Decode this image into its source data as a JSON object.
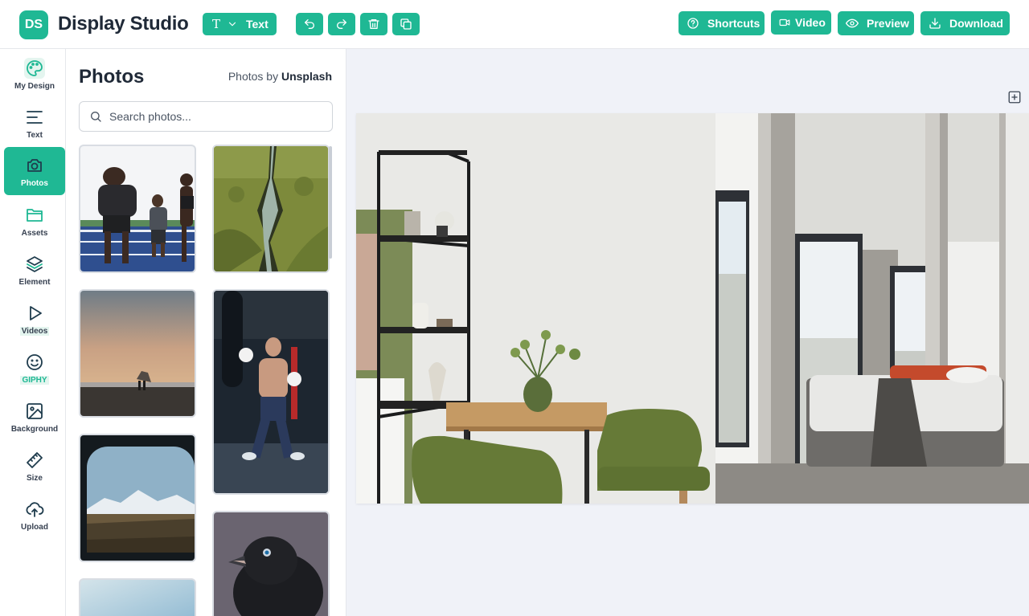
{
  "app": {
    "logo_initials": "DS",
    "title": "Display Studio",
    "accent": "#1fb894"
  },
  "toolbar": {
    "text_tool_glyph": "T",
    "text_tool_label": "Text",
    "undo_icon": "undo-icon",
    "redo_icon": "redo-icon",
    "delete_icon": "trash-icon",
    "duplicate_icon": "duplicate-icon"
  },
  "header_actions": {
    "shortcuts_label": "Shortcuts",
    "video_label": "Video",
    "preview_label": "Preview",
    "download_label": "Download"
  },
  "sidebar": {
    "items": [
      {
        "label": "My Design",
        "icon": "palette-icon"
      },
      {
        "label": "Text",
        "icon": "text-lines-icon"
      },
      {
        "label": "Photos",
        "icon": "camera-icon",
        "active": true
      },
      {
        "label": "Assets",
        "icon": "folder-icon"
      },
      {
        "label": "Element",
        "icon": "layers-icon"
      },
      {
        "label": "Videos",
        "icon": "play-icon"
      },
      {
        "label": "GIPHY",
        "icon": "smiley-icon"
      },
      {
        "label": "Background",
        "icon": "image-icon"
      },
      {
        "label": "Size",
        "icon": "ruler-icon"
      },
      {
        "label": "Upload",
        "icon": "cloud-upload-icon"
      }
    ]
  },
  "photos_panel": {
    "title": "Photos",
    "credit_prefix": "Photos by",
    "credit_source": "Unsplash",
    "search_placeholder": "Search photos...",
    "thumbnails": [
      "athletes-on-track",
      "aerial-canyon",
      "beach-sunset-couple",
      "boxer-training",
      "mountains-in-car-mirror",
      "black-bird-closeup",
      "sky-partial"
    ]
  },
  "canvas": {
    "add_page_icon": "plus-square-icon",
    "artwork": "interior-dining-and-bedroom-photo"
  }
}
